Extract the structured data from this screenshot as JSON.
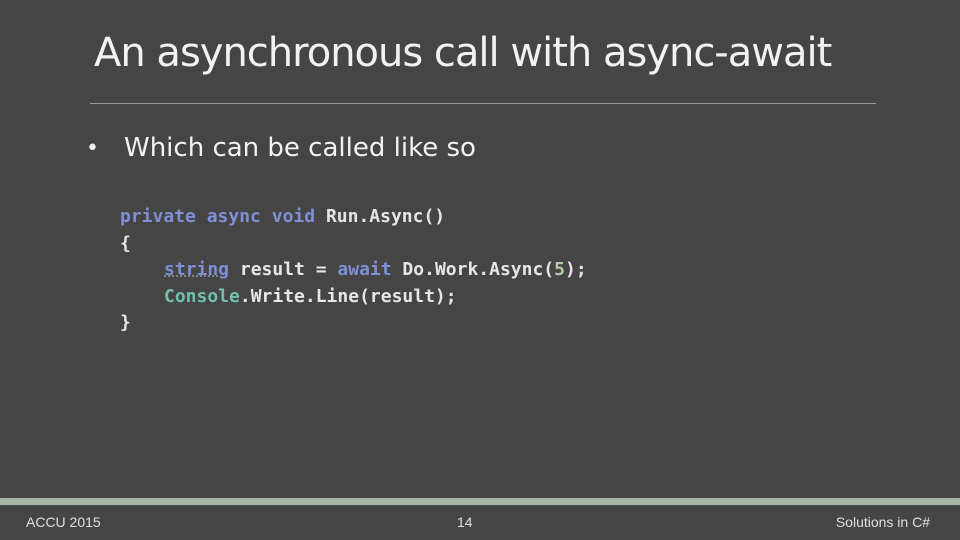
{
  "slide": {
    "title": "An asynchronous call with async-await",
    "bullet": {
      "marker": "•",
      "text": "Which can be called like so"
    },
    "code": {
      "line1": {
        "kw1": "private",
        "kw2": "async",
        "kw3": "void",
        "name": "Run",
        "rest": ".Async()"
      },
      "line2": "{",
      "line3": {
        "type": "string",
        "mid": " result = ",
        "kw": "await",
        "call": " Do.Work.Async(",
        "num": "5",
        "end": ");"
      },
      "line4": {
        "type": "Console",
        "rest": ".Write.Line(result);"
      },
      "line5": "}"
    },
    "footer": {
      "left": "ACCU 2015",
      "page": "14",
      "right": "Solutions in C#"
    }
  },
  "colors": {
    "background": "#454545",
    "keyword": "#7f8fd8",
    "type": "#6fc0ac",
    "footer_bar": "#a7b7a7"
  }
}
